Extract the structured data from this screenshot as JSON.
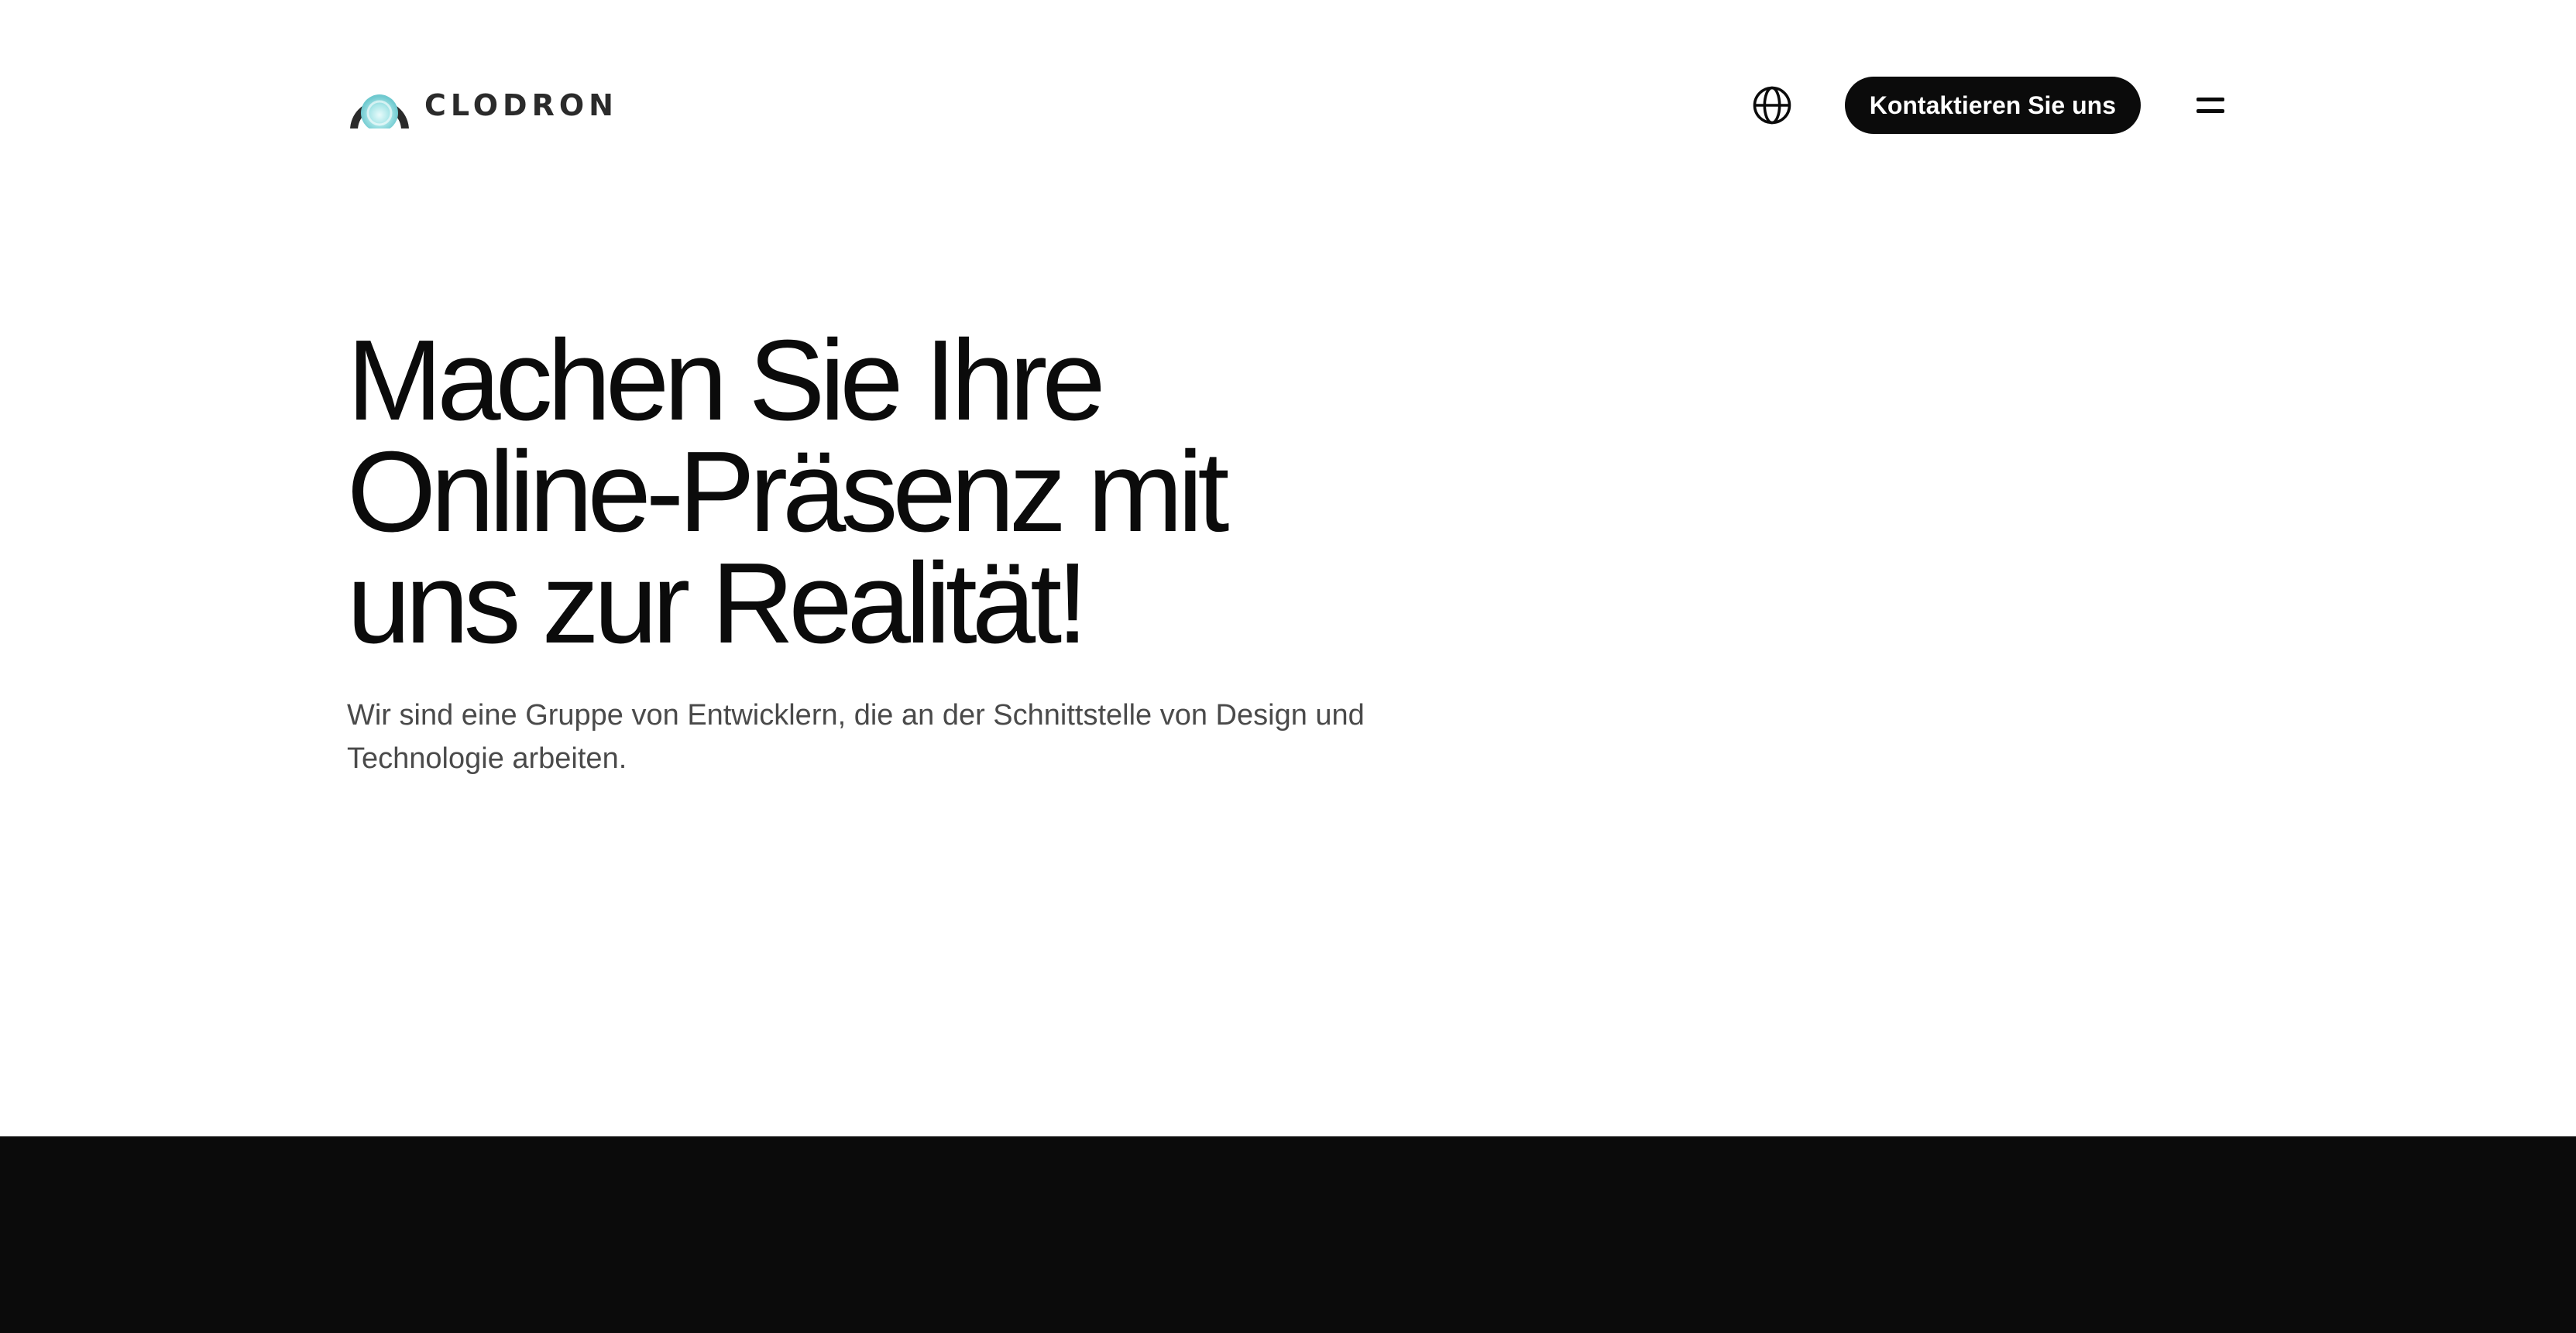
{
  "header": {
    "brand_name": "CLODRON",
    "contact_label": "Kontaktieren Sie uns",
    "icons": {
      "logo": "clodron-logo-icon",
      "language": "globe-icon",
      "menu": "menu-icon"
    }
  },
  "hero": {
    "title_lines": [
      "Machen Sie Ihre",
      "Online-Präsenz mit",
      "uns zur Realität!"
    ],
    "lead": "Wir sind eine Gruppe von Entwicklern, die an der Schnittstelle von Design und Technologie arbeiten."
  },
  "colors": {
    "text": "#0b0b0b",
    "muted_text": "#4a4a4a",
    "background": "#ffffff",
    "dark_band": "#0b0b0b",
    "logo_accent": "#9fe3e6"
  }
}
